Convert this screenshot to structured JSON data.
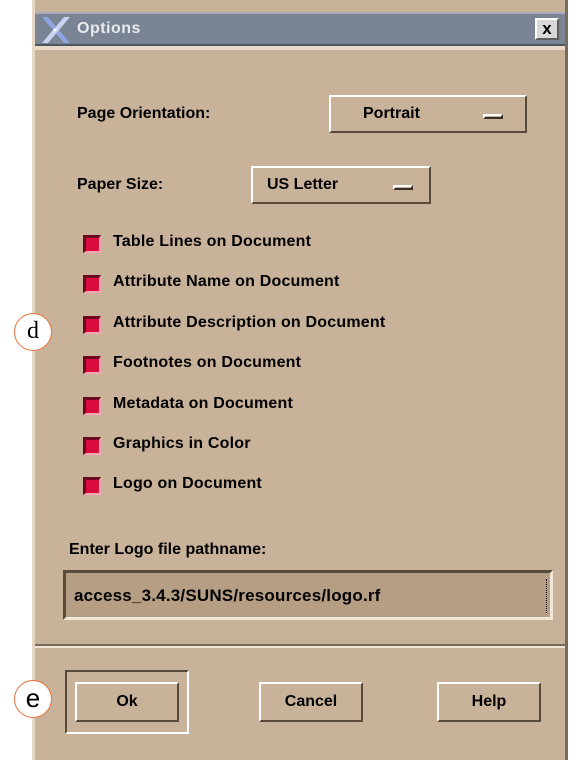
{
  "window": {
    "title": "Options",
    "close_label": "x"
  },
  "page_orientation": {
    "label": "Page Orientation:",
    "value": "Portrait"
  },
  "paper_size": {
    "label": "Paper Size:",
    "value": "US Letter"
  },
  "checkboxes": [
    {
      "label": "Table Lines on Document",
      "checked": true
    },
    {
      "label": "Attribute Name on Document",
      "checked": true
    },
    {
      "label": "Attribute Description on Document",
      "checked": true
    },
    {
      "label": "Footnotes on Document",
      "checked": true
    },
    {
      "label": "Metadata on Document",
      "checked": true
    },
    {
      "label": "Graphics in Color",
      "checked": true
    },
    {
      "label": "Logo on Document",
      "checked": true
    }
  ],
  "logo_path": {
    "label": "Enter Logo file pathname:",
    "value": "access_3.4.3/SUNS/resources/logo.rf"
  },
  "buttons": {
    "ok": "Ok",
    "cancel": "Cancel",
    "help": "Help"
  },
  "callouts": {
    "d": "d",
    "e": "e"
  },
  "colors": {
    "dialog_bg": "#c8b29a",
    "titlebar_bg": "#7b8494",
    "checkbox_on": "#d90d3c",
    "callout_border": "#e8703a"
  }
}
